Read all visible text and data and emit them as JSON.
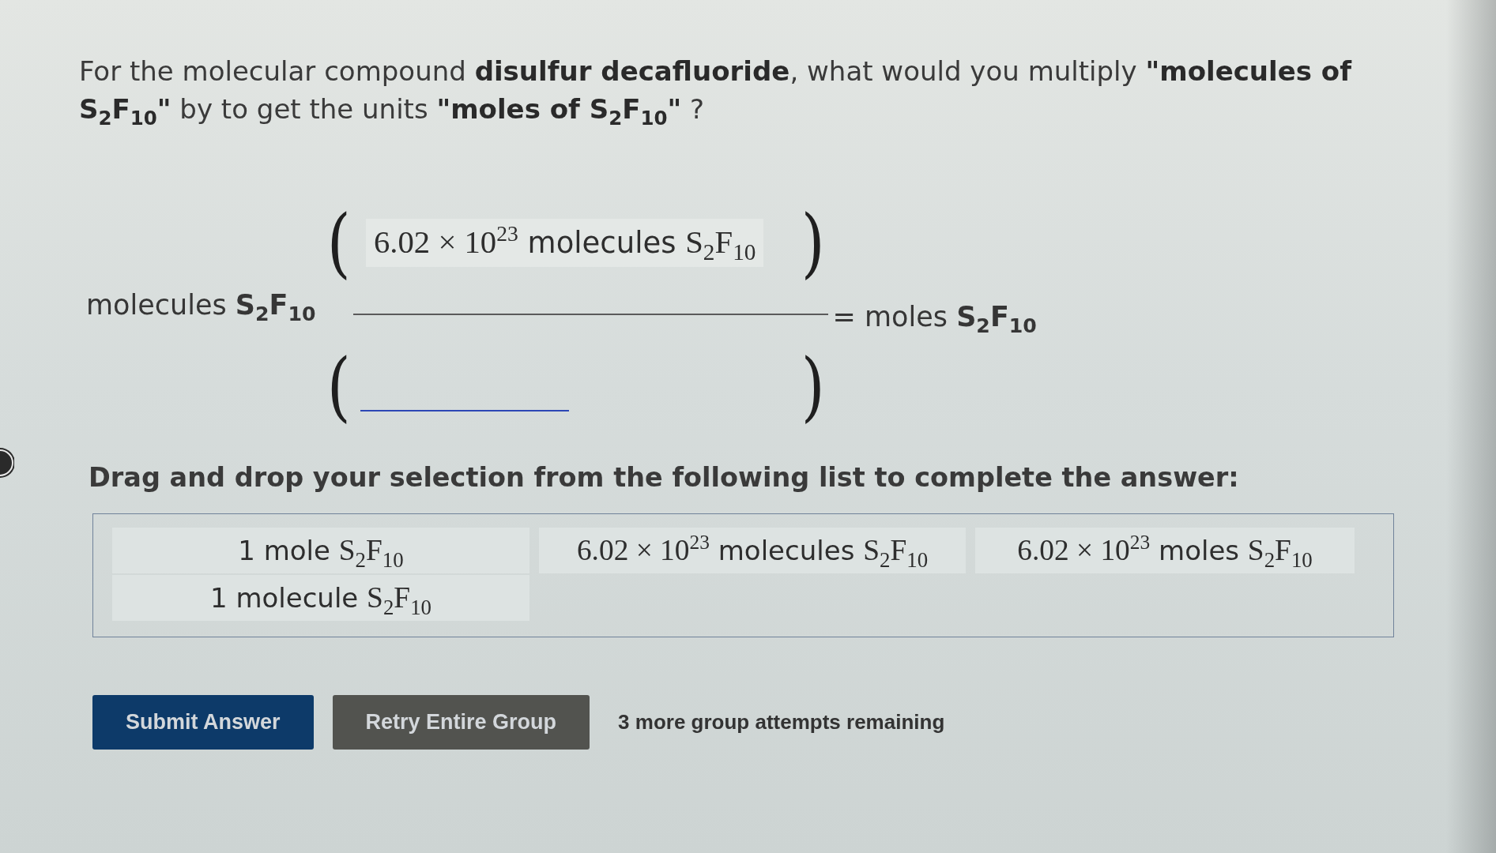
{
  "question": {
    "text": "For the molecular compound **disulfur decafluoride**, what would you multiply **\"molecules of S$_{2}$F$_{10}$\"** by to get the units **\"moles of S$_{2}$F$_{10}$\"** ?"
  },
  "equation": {
    "given": "molecules **S$_{2}$F$_{10}$**",
    "numerator": {
      "open": "(",
      "answer": {
        "number": "6.02 × 10$^{23}$",
        "unit": "molecules",
        "formula": "S$_{2}$F$_{10}$"
      },
      "close": ")"
    },
    "denominator": {
      "open": "(",
      "close": ")"
    },
    "result": "= moles **S$_{2}$F$_{10}$**"
  },
  "instruction": "Drag and drop your selection from the following list to complete the answer:",
  "choices": [
    {
      "unit": "1 mole",
      "formula": "S$_{2}$F$_{10}$"
    },
    {
      "number": "6.02 × 10$^{23}$",
      "unit": "molecules",
      "formula": "S$_{2}$F$_{10}$"
    },
    {
      "number": "6.02 × 10$^{23}$",
      "unit": "moles",
      "formula": "S$_{2}$F$_{10}$"
    },
    {
      "unit": "1 molecule",
      "formula": "S$_{2}$F$_{10}$"
    }
  ],
  "buttons": [
    {
      "label": "Submit Answer",
      "kind": "primary"
    },
    {
      "label": "Retry Entire Group",
      "kind": "secondary"
    }
  ],
  "attempts": "3 more group attempts remaining"
}
